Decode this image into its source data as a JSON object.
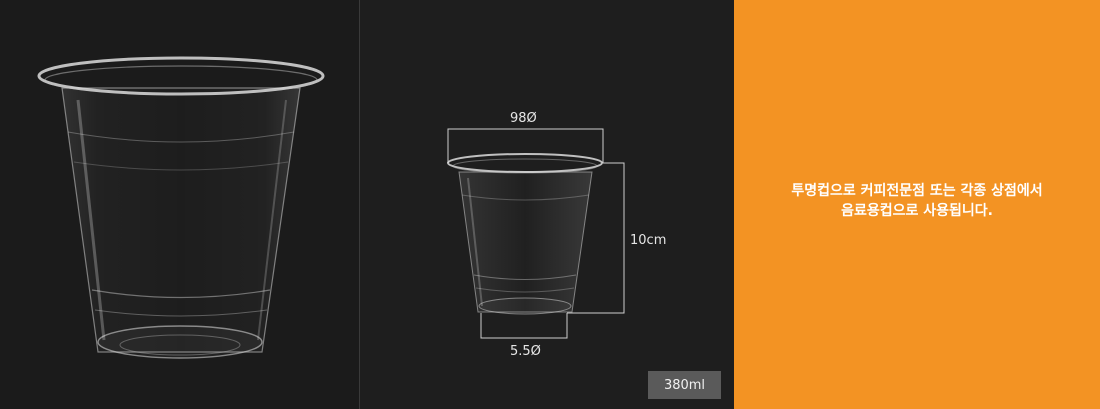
{
  "product": {
    "dimensions": {
      "top_diameter": "98Ø",
      "height": "10cm",
      "bottom_diameter": "5.5Ø"
    },
    "volume_label": "380ml",
    "description": {
      "line1": "투명컵으로 커피전문점 또는 각종 상점에서",
      "line2": "음료용컵으로 사용됩니다."
    }
  },
  "colors": {
    "accent_panel": "#f39323",
    "dark_background": "#1e1e1e",
    "badge": "#5a5a5a"
  }
}
